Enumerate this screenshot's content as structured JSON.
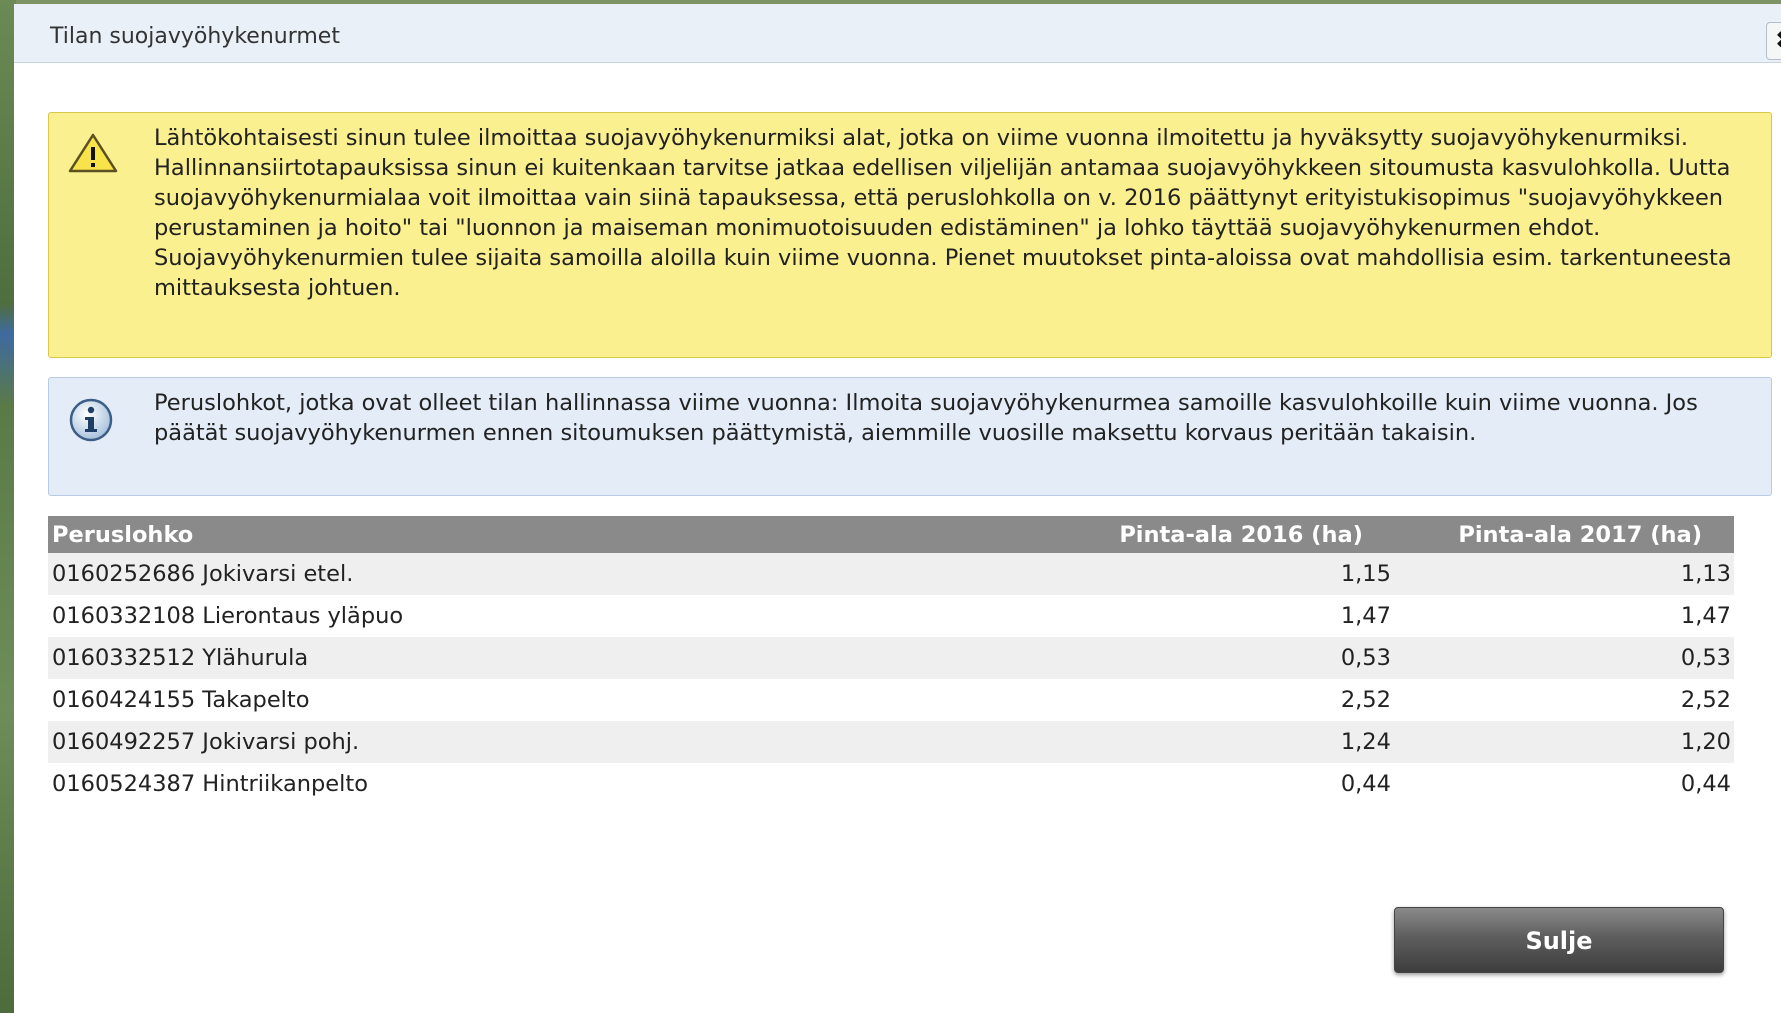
{
  "dialog": {
    "title": "Tilan suojavyöhykenurmet",
    "close_icon": "close-icon",
    "close_label": "✖"
  },
  "warning": {
    "icon": "warning-icon",
    "text": "Lähtökohtaisesti sinun tulee ilmoittaa suojavyöhykenurmiksi alat, jotka on viime vuonna ilmoitettu ja hyväksytty suojavyöhykenurmiksi. Hallinnansiirtotapauksissa sinun ei kuitenkaan tarvitse jatkaa edellisen viljelijän antamaa suojavyöhykkeen sitoumusta kasvulohkolla. Uutta suojavyöhykenurmialaa voit ilmoittaa vain siinä tapauksessa, että peruslohkolla on v. 2016 päättynyt erityistukisopimus \"suojavyöhykkeen perustaminen ja hoito\" tai \"luonnon ja maiseman monimuotoisuuden edistäminen\" ja lohko täyttää suojavyöhykenurmen ehdot. Suojavyöhykenurmien tulee sijaita samoilla aloilla kuin viime vuonna. Pienet muutokset pinta-aloissa ovat mahdollisia esim. tarkentuneesta mittauksesta johtuen.",
    "color": "#fbf08f"
  },
  "info": {
    "icon": "info-icon",
    "text": "Peruslohkot, jotka ovat olleet tilan hallinnassa viime vuonna: Ilmoita suojavyöhykenurmea samoille kasvulohkoille kuin viime vuonna. Jos päätät suojavyöhykenurmen ennen sitoumuksen päättymistä, aiemmille vuosille maksettu korvaus peritään takaisin.",
    "color": "#e3ecf7"
  },
  "table": {
    "headers": [
      "Peruslohko",
      "Pinta-ala 2016 (ha)",
      "Pinta-ala 2017 (ha)"
    ],
    "rows": [
      [
        "0160252686 Jokivarsi etel.",
        "1,15",
        "1,13"
      ],
      [
        "0160332108 Lierontaus yläpuo",
        "1,47",
        "1,47"
      ],
      [
        "0160332512 Ylähurula",
        "0,53",
        "0,53"
      ],
      [
        "0160424155 Takapelto",
        "2,52",
        "2,52"
      ],
      [
        "0160492257 Jokivarsi pohj.",
        "1,24",
        "1,20"
      ],
      [
        "0160524387 Hintriikanpelto",
        "0,44",
        "0,44"
      ]
    ]
  },
  "footer": {
    "close_button_label": "Sulje"
  }
}
